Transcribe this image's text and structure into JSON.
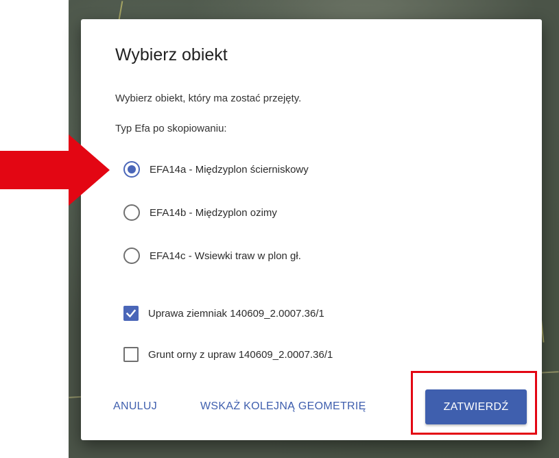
{
  "dialog": {
    "title": "Wybierz obiekt",
    "description": "Wybierz obiekt, który ma zostać przejęty.",
    "efa_label": "Typ Efa po skopiowaniu:",
    "radio_options": [
      {
        "label": "EFA14a - Międzyplon ścierniskowy",
        "selected": true
      },
      {
        "label": "EFA14b - Międzyplon ozimy",
        "selected": false
      },
      {
        "label": "EFA14c - Wsiewki traw w plon gł.",
        "selected": false
      }
    ],
    "checkboxes": [
      {
        "label": "Uprawa ziemniak 140609_2.0007.36/1",
        "checked": true
      },
      {
        "label": "Grunt orny z upraw 140609_2.0007.36/1",
        "checked": false
      }
    ],
    "buttons": {
      "cancel": "ANULUJ",
      "next_geometry": "WSKAŻ KOLEJNĄ GEOMETRIĘ",
      "confirm": "ZATWIERDŹ"
    }
  },
  "colors": {
    "accent": "#4a66b8",
    "button": "#3f5fae",
    "annotation": "#e30613"
  }
}
